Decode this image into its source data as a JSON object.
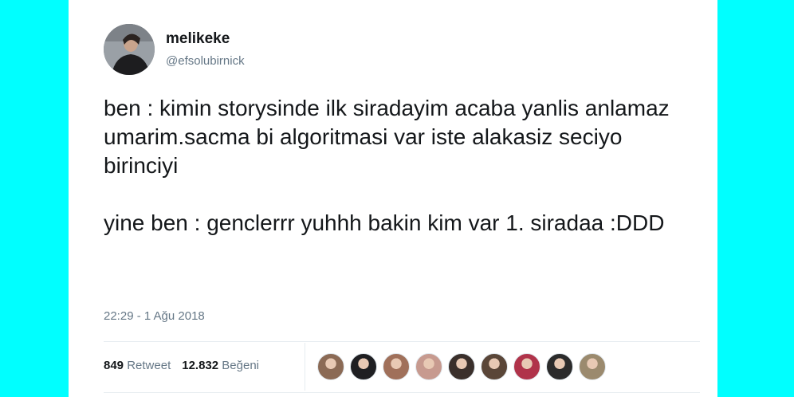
{
  "user": {
    "display_name": "melikeke",
    "handle": "@efsolubirnick"
  },
  "tweet": {
    "paragraphs": [
      "ben : kimin storysinde ilk siradayim acaba yanlis anlamaz umarim.sacma bi algoritmasi var iste alakasiz seciyo birinciyi",
      "yine ben : genclerrr yuhhh bakin kim var 1. siradaa :DDD"
    ],
    "timestamp": "22:29 - 1 Ağu 2018"
  },
  "stats": {
    "retweet_count": "849",
    "retweet_label": "Retweet",
    "like_count": "12.832",
    "like_label": "Beğeni"
  },
  "likers": [
    {
      "icon": "liker-avatar",
      "color": "#8b6a55"
    },
    {
      "icon": "liker-avatar",
      "color": "#1f1f22"
    },
    {
      "icon": "liker-avatar",
      "color": "#a0705a"
    },
    {
      "icon": "liker-avatar",
      "color": "#c79a8f"
    },
    {
      "icon": "liker-avatar",
      "color": "#3a2f2b"
    },
    {
      "icon": "liker-avatar",
      "color": "#5a4638"
    },
    {
      "icon": "liker-avatar",
      "color": "#b0334a"
    },
    {
      "icon": "liker-avatar",
      "color": "#2b2b2b"
    },
    {
      "icon": "liker-avatar",
      "color": "#9b8a6e"
    }
  ],
  "colors": {
    "page_background": "#00ffff",
    "card_background": "#ffffff",
    "text_primary": "#14171a",
    "text_secondary": "#657786"
  }
}
